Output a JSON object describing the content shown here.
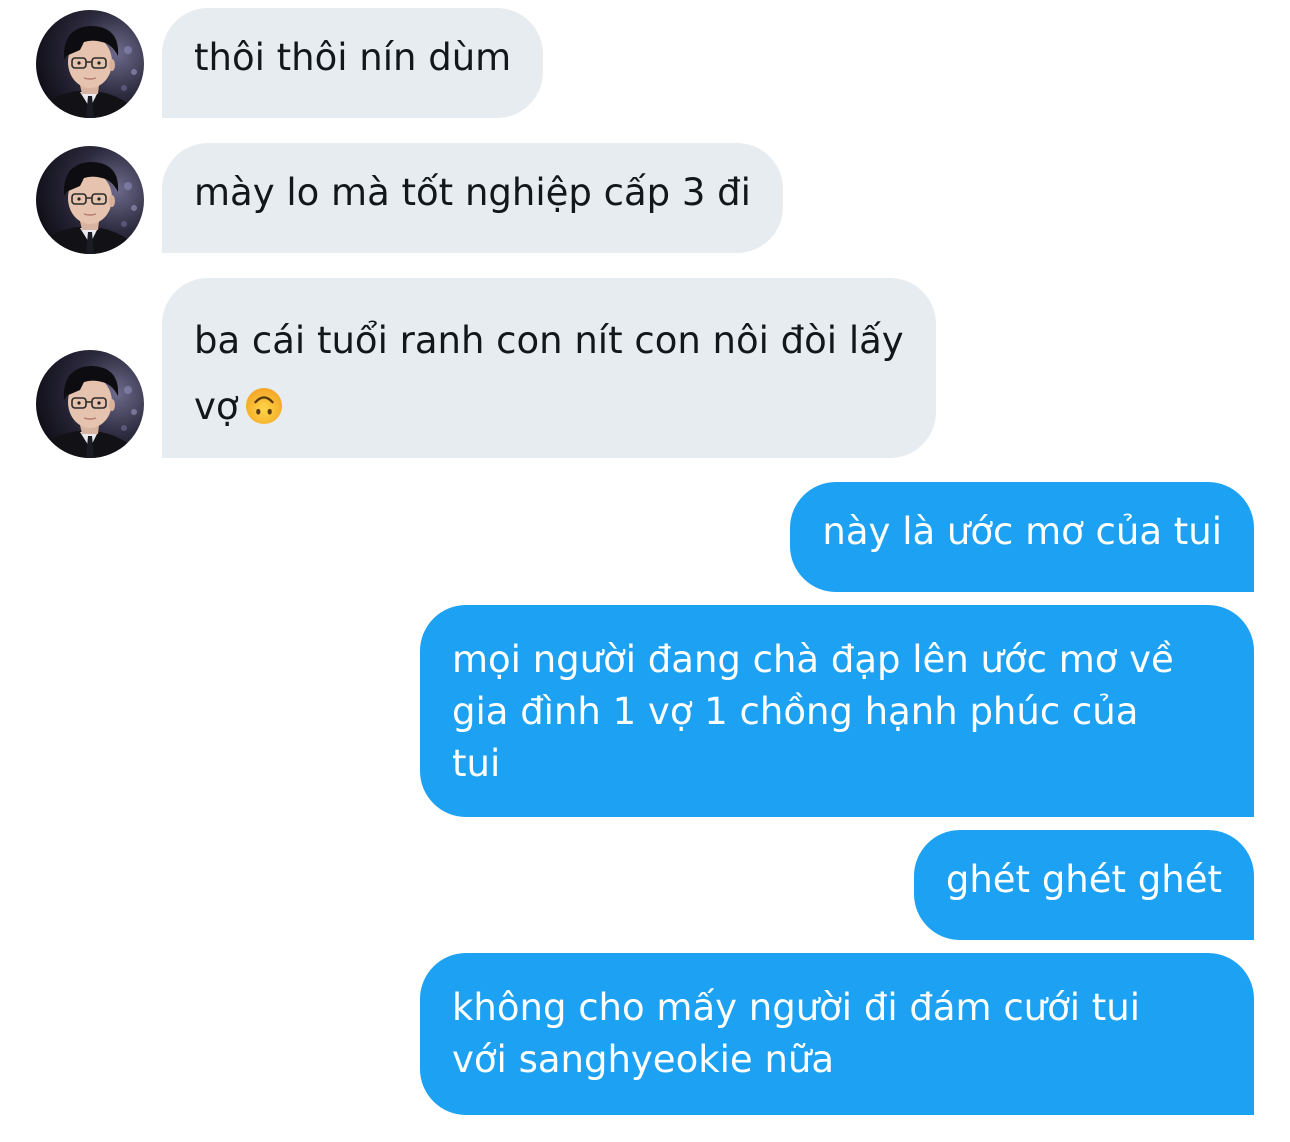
{
  "conversation": {
    "incoming": [
      {
        "lines": [
          "thôi thôi nín dùm"
        ]
      },
      {
        "lines": [
          "mày lo mà tốt nghiệp cấp 3 đi"
        ]
      },
      {
        "lines": [
          "ba cái tuổi ranh con nít con nôi đòi lấy",
          "vợ"
        ],
        "emoji": "upside-down-face"
      }
    ],
    "outgoing": [
      {
        "lines": [
          "này là ước mơ của tui"
        ]
      },
      {
        "lines": [
          "mọi người đang chà đạp lên ước mơ về",
          "gia đình 1 vợ 1 chồng hạnh phúc của",
          "tui"
        ]
      },
      {
        "lines": [
          "ghét ghét ghét"
        ]
      },
      {
        "lines": [
          "không cho mấy người đi đám cưới tui",
          "với sanghyeokie nữa"
        ]
      }
    ]
  },
  "colors": {
    "incoming_bubble": "#e6ecf0",
    "outgoing_bubble": "#1da1f2",
    "incoming_text": "#14171a",
    "outgoing_text": "#ffffff"
  },
  "icons": {
    "avatar": "user-avatar-photo",
    "emoji": "upside-down-face-emoji"
  }
}
